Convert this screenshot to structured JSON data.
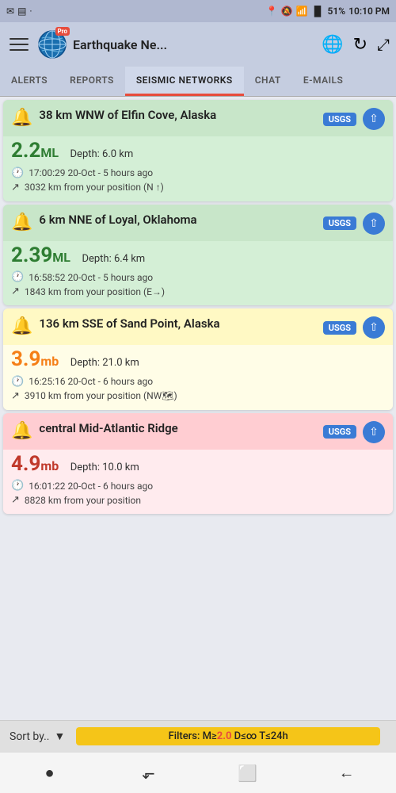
{
  "statusBar": {
    "leftIcons": [
      "✉",
      "☰",
      "📶"
    ],
    "signal": "📶",
    "wifi": "WiFi",
    "battery": "51%",
    "time": "10:10 PM"
  },
  "topBar": {
    "title": "Earthquake Ne...",
    "proBadge": "Pro"
  },
  "tabs": [
    {
      "id": "alerts",
      "label": "ALERTS",
      "active": false
    },
    {
      "id": "reports",
      "label": "REPORTS",
      "active": false
    },
    {
      "id": "seismic",
      "label": "SEISMIC NETWORKS",
      "active": true
    },
    {
      "id": "chat",
      "label": "CHAT",
      "active": false
    },
    {
      "id": "emails",
      "label": "E-MAILS",
      "active": false
    }
  ],
  "earthquakes": [
    {
      "id": 1,
      "title": "38 km WNW of Elfin Cove, Alaska",
      "source": "USGS",
      "magnitude": "2.2",
      "magType": "ML",
      "depth": "Depth: 6.0 km",
      "time": "17:00:29 20-Oct - 5 hours ago",
      "distance": "3032 km from your position (N ↑)",
      "color": "green"
    },
    {
      "id": 2,
      "title": "6 km NNE of Loyal, Oklahoma",
      "source": "USGS",
      "magnitude": "2.39",
      "magType": "ML",
      "depth": "Depth: 6.4 km",
      "time": "16:58:52 20-Oct - 5 hours ago",
      "distance": "1843 km from your position (E→)",
      "color": "green"
    },
    {
      "id": 3,
      "title": "136 km SSE of Sand Point, Alaska",
      "source": "USGS",
      "magnitude": "3.9",
      "magType": "mb",
      "depth": "Depth: 21.0 km",
      "time": "16:25:16 20-Oct - 6 hours ago",
      "distance": "3910 km from your position (NW🗺)",
      "color": "yellow"
    },
    {
      "id": 4,
      "title": "central Mid-Atlantic Ridge",
      "source": "USGS",
      "magnitude": "4.9",
      "magType": "mb",
      "depth": "Depth: 10.0 km",
      "time": "16:01:22 20-Oct - 6 hours ago",
      "distance": "8828 km from your position",
      "color": "pink"
    }
  ],
  "sortBar": {
    "label": "Sort by..",
    "filterText": "Filters: M≥",
    "filterMag": "2.0",
    "filterRest": " D≤∞ T≤24h"
  },
  "navBar": {
    "buttons": [
      "●",
      "⬐",
      "⬜",
      "⬅"
    ]
  }
}
